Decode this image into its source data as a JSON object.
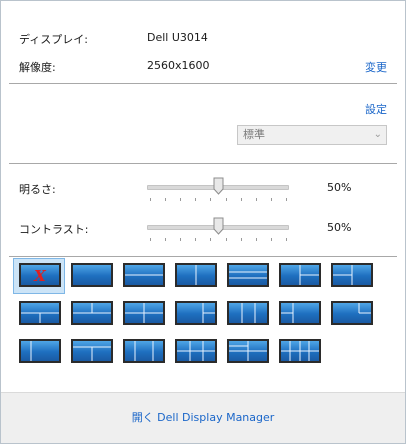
{
  "display": {
    "label": "ディスプレイ:",
    "value": "Dell U3014"
  },
  "resolution": {
    "label": "解像度:",
    "value": "2560x1600",
    "change_link": "変更"
  },
  "settings": {
    "link": "設定",
    "mode_selected": "標準"
  },
  "brightness": {
    "label": "明るさ:",
    "value_text": "50%",
    "value": 50
  },
  "contrast": {
    "label": "コントラスト:",
    "value_text": "50%",
    "value": 50
  },
  "layouts": {
    "selected_index": 0,
    "items": [
      "none",
      "full",
      "top-bottom",
      "left-right",
      "three-rows",
      "left-half-right-split",
      "right-half-left-split",
      "top-half-bottom-split",
      "bottom-half-top-split",
      "quad",
      "wide-left-two-right",
      "three-columns",
      "left-two-right-wide",
      "single-right-corner",
      "left-narrow",
      "split-with-top-strip",
      "wide-center",
      "six-grid",
      "quad-wide",
      "columns-four"
    ]
  },
  "footer": {
    "open_link": "開く Dell Display Manager"
  },
  "colors": {
    "accent": "#1a66c9",
    "layout_blue": "#2a7fd2",
    "selected_bg": "#cce4f7",
    "close_x": "#e02020"
  }
}
